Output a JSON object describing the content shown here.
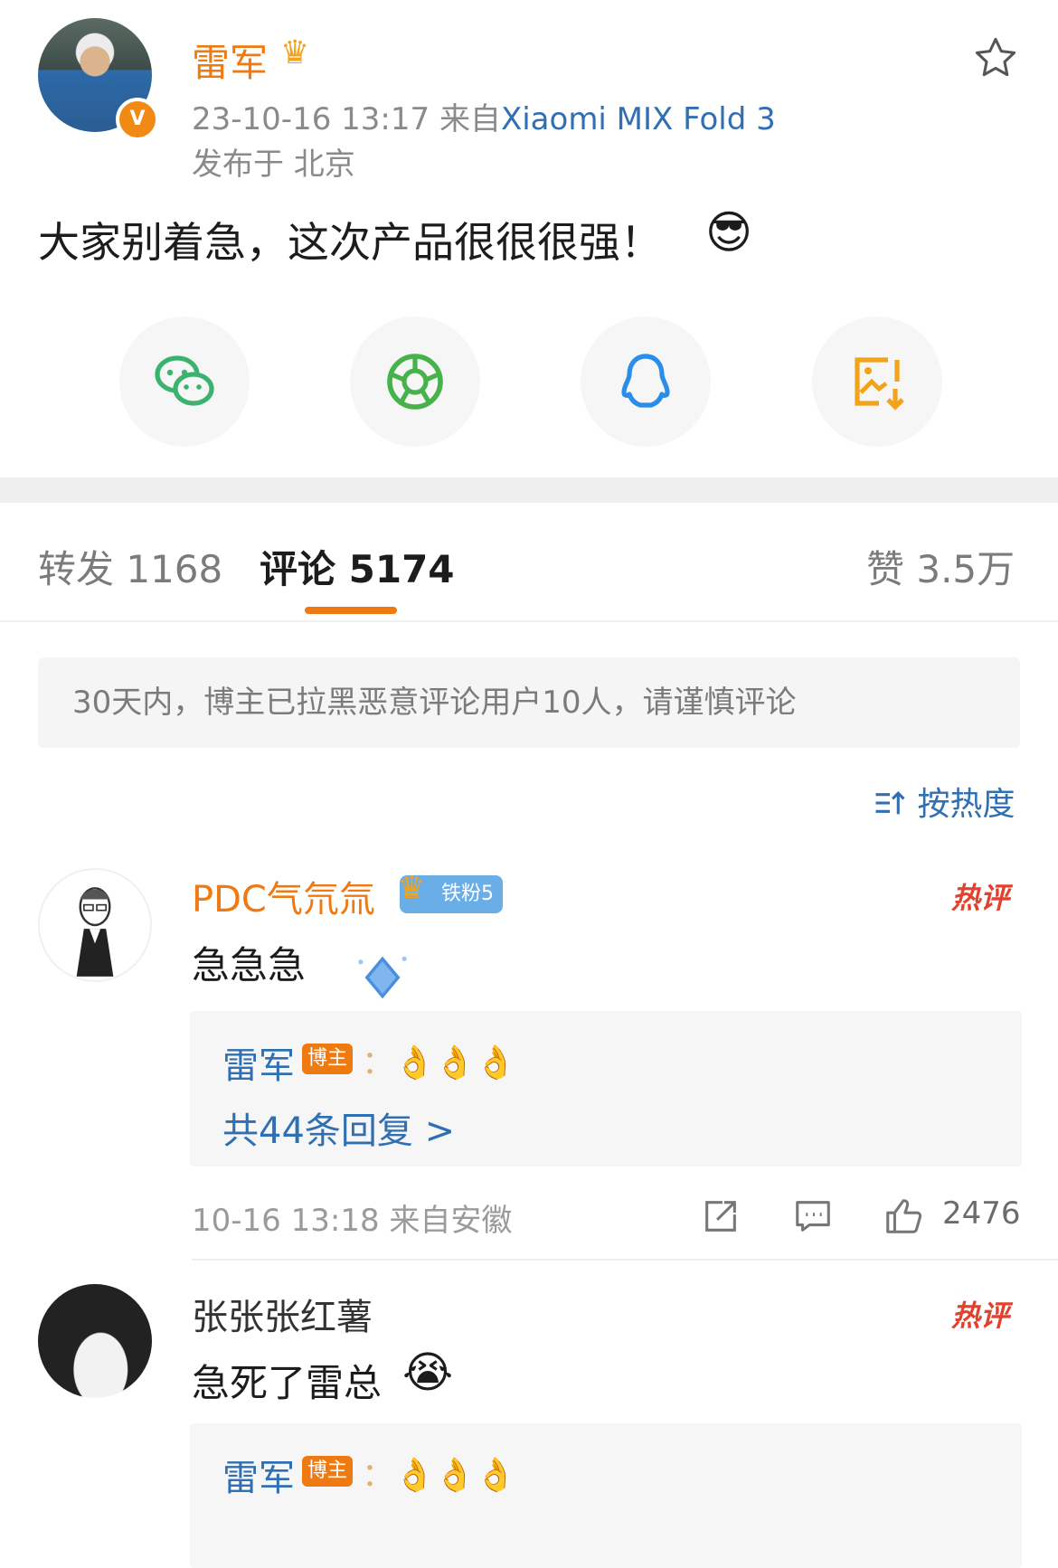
{
  "post": {
    "author": "雷军",
    "time": "23-10-16 13:17",
    "from_label": "来自",
    "device": "Xiaomi MIX Fold 3",
    "location": "发布于 北京",
    "text": "大家别着急，这次产品很很很强！",
    "emoji": "😎"
  },
  "share": [
    {
      "name": "wechat",
      "color": "#3bb36e"
    },
    {
      "name": "moments",
      "color": "#45b24a"
    },
    {
      "name": "qq",
      "color": "#2a8ee8"
    },
    {
      "name": "save-image",
      "color": "#f3a31a"
    }
  ],
  "tabs": {
    "repost": "转发 1168",
    "comments": "评论 5174",
    "likes": "赞 3.5万"
  },
  "notice": "30天内，博主已拉黑恶意评论用户10人，请谨慎评论",
  "sort_label": "按热度",
  "comments": [
    {
      "user": "PDC气氘氚",
      "fan_badge": "铁粉5",
      "hot": "热评",
      "text": "急急急",
      "reply_user": "雷军",
      "reply_badge": "博主",
      "reply_text": "：👌👌👌",
      "reply_more": "共44条回复 >",
      "meta": "10-16 13:18 来自安徽",
      "likes": "2476"
    },
    {
      "user": "张张张红薯",
      "hot": "热评",
      "text": "急死了雷总",
      "emoji": "😭",
      "reply_user": "雷军",
      "reply_badge": "博主",
      "reply_text": "：👌👌👌"
    }
  ]
}
